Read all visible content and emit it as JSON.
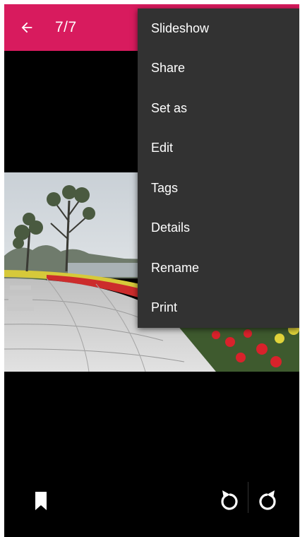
{
  "toolbar": {
    "counter": "7/7",
    "accent_color": "#d81b5e",
    "back_icon": "arrow-left-icon"
  },
  "overflow_menu": {
    "items": [
      {
        "label": "Slideshow"
      },
      {
        "label": "Share"
      },
      {
        "label": "Set as"
      },
      {
        "label": "Edit"
      },
      {
        "label": "Tags"
      },
      {
        "label": "Details"
      },
      {
        "label": "Rename"
      },
      {
        "label": "Print"
      }
    ]
  },
  "bottom_bar": {
    "left_icon": "bookmark-icon",
    "right_icons": [
      "rotate-left-icon",
      "rotate-right-icon"
    ]
  }
}
